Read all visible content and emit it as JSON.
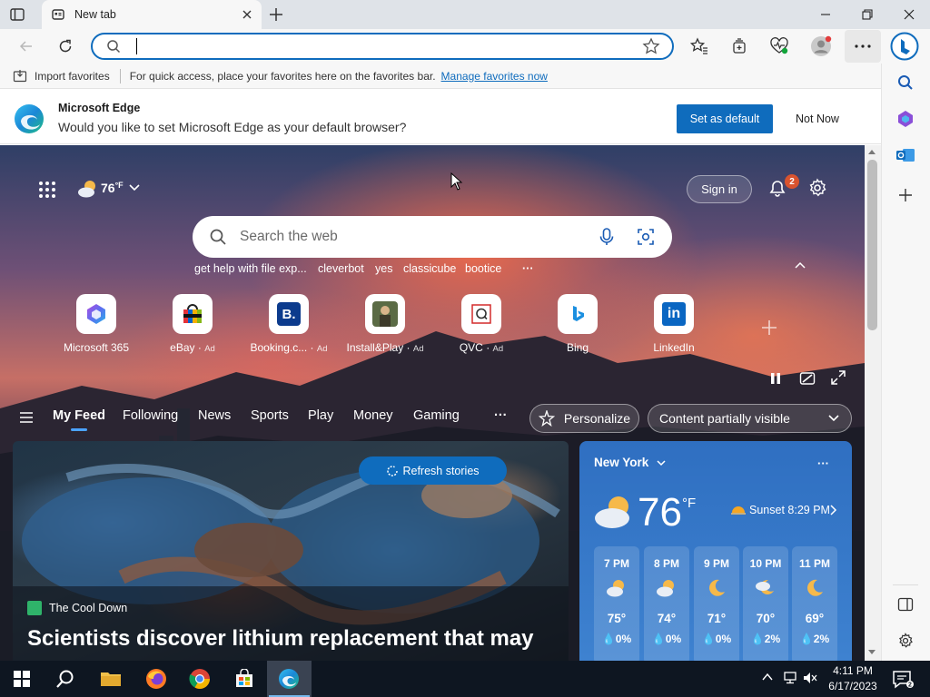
{
  "browser": {
    "tab_title": "New tab",
    "address_value": "",
    "favorites_bar": {
      "import_label": "Import favorites",
      "message": "For quick access, place your favorites here on the favorites bar.",
      "manage_link": "Manage favorites now"
    }
  },
  "banner": {
    "title": "Microsoft Edge",
    "message": "Would you like to set Microsoft Edge as your default browser?",
    "primary_button": "Set as default",
    "secondary_button": "Not Now"
  },
  "page": {
    "weather_temp": "76",
    "weather_unit": "°F",
    "sign_in": "Sign in",
    "notification_count": "2",
    "search_placeholder": "Search the web",
    "suggestions": [
      "get help with file exp...",
      "cleverbot",
      "yes",
      "classicube",
      "bootice"
    ],
    "more": "···",
    "quick_links": [
      {
        "label": "Microsoft 365",
        "ad": ""
      },
      {
        "label": "eBay",
        "ad": "Ad"
      },
      {
        "label": "Booking.c...",
        "ad": "Ad"
      },
      {
        "label": "Install&Play",
        "ad": "Ad"
      },
      {
        "label": "QVC",
        "ad": "Ad"
      },
      {
        "label": "Bing",
        "ad": ""
      },
      {
        "label": "LinkedIn",
        "ad": ""
      }
    ],
    "feed_tabs": [
      "My Feed",
      "Following",
      "News",
      "Sports",
      "Play",
      "Money",
      "Gaming"
    ],
    "feed_more": "···",
    "personalize": "Personalize",
    "content_visibility": "Content partially visible",
    "refresh": "Refresh stories",
    "news": {
      "source": "The Cool Down",
      "headline": "Scientists discover lithium replacement that may"
    },
    "weather_card": {
      "location": "New York",
      "temp": "76",
      "unit": "°F",
      "sunset": "Sunset 8:29 PM",
      "more": "···",
      "hours": [
        {
          "time": "7 PM",
          "temp": "75°",
          "precip": "0%",
          "icon": "partly-sunny-icon"
        },
        {
          "time": "8 PM",
          "temp": "74°",
          "precip": "0%",
          "icon": "partly-sunny-icon"
        },
        {
          "time": "9 PM",
          "temp": "71°",
          "precip": "0%",
          "icon": "moon-icon"
        },
        {
          "time": "10 PM",
          "temp": "70°",
          "precip": "2%",
          "icon": "cloudy-night-icon"
        },
        {
          "time": "11 PM",
          "temp": "69°",
          "precip": "2%",
          "icon": "moon-icon"
        }
      ]
    }
  },
  "taskbar": {
    "time": "4:11 PM",
    "date": "6/17/2023"
  },
  "colors": {
    "accent": "#0f6cbd",
    "weather_card": "#3e82d0",
    "taskbar": "#0e1621"
  }
}
